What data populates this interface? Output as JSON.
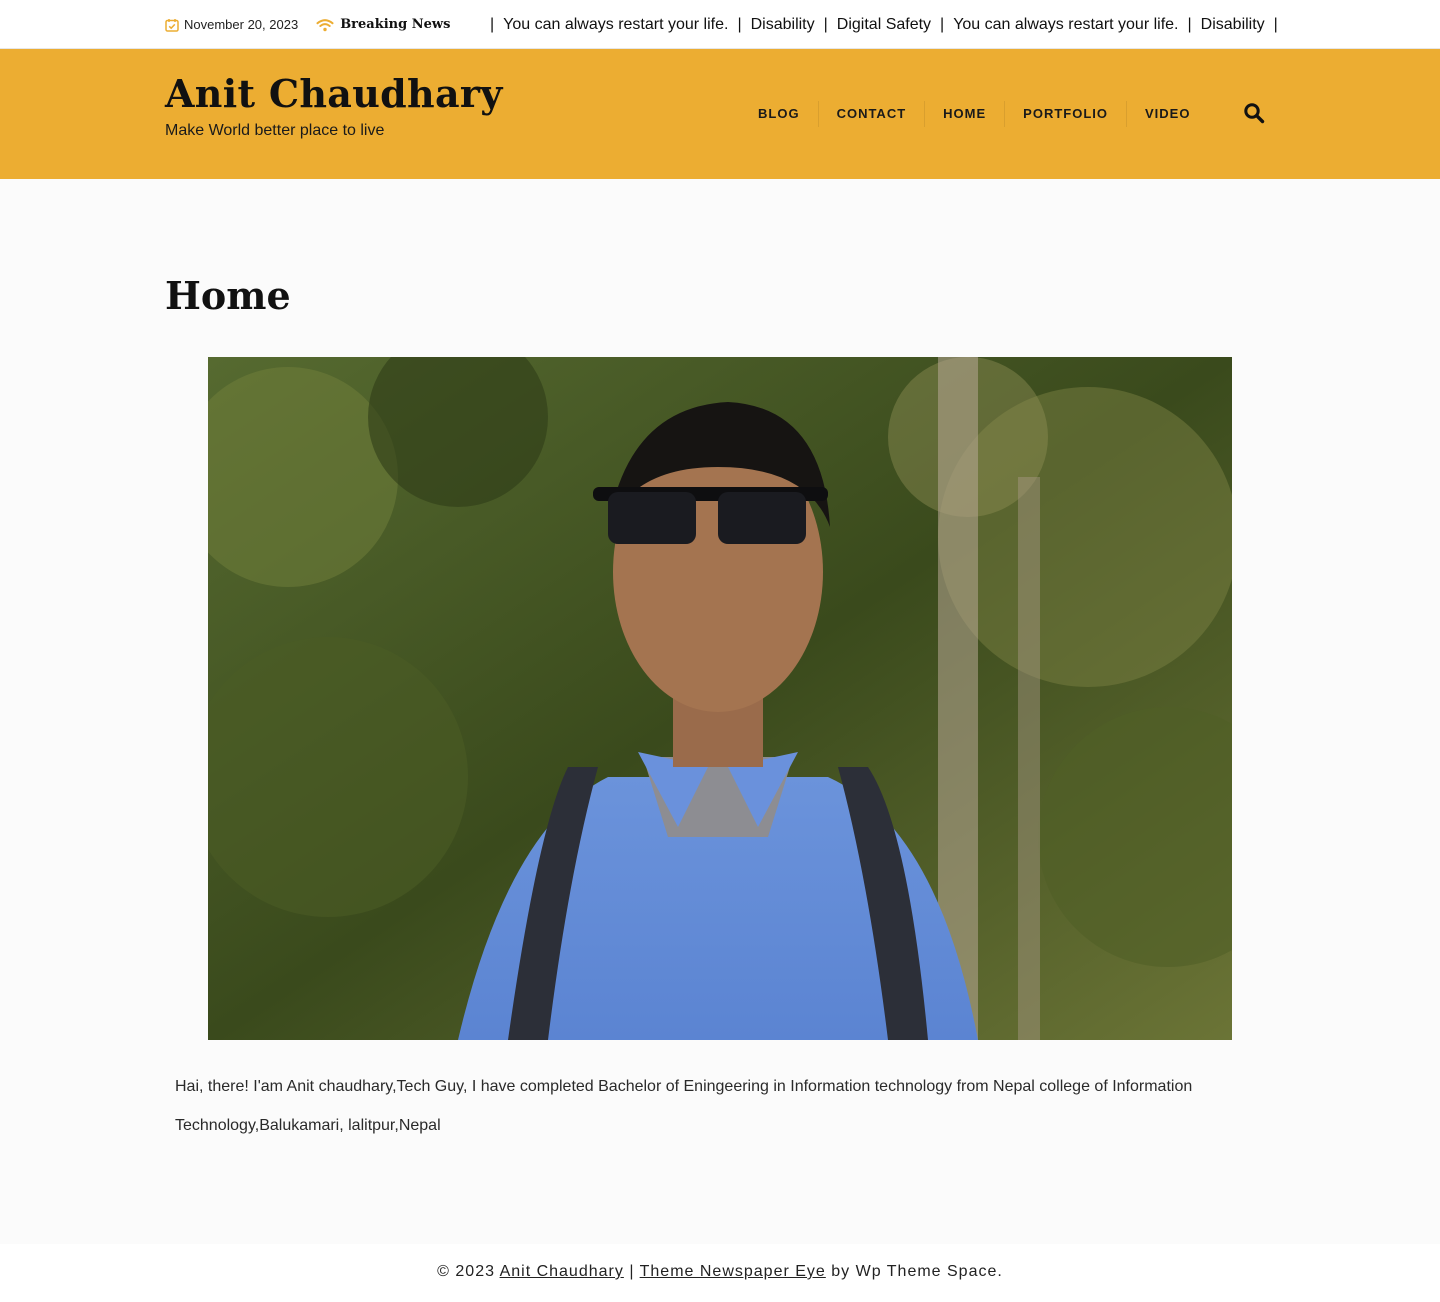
{
  "topbar": {
    "date": "November 20, 2023",
    "breaking_label": "Breaking News",
    "ticker": [
      "You can always restart your life.",
      "Disability",
      "Digital Safety",
      "You can always restart your life.",
      "Disability"
    ],
    "separator": "|"
  },
  "header": {
    "site_title": "Anit Chaudhary",
    "tagline": "Make World better place to live",
    "nav": [
      "BLOG",
      "CONTACT",
      "HOME",
      "PORTFOLIO",
      "VIDEO"
    ],
    "search_icon": "search-icon",
    "accent_color": "#ecad32"
  },
  "page": {
    "title": "Home",
    "intro": "Hai, there! I'am Anit chaudhary,Tech Guy, I have completed Bachelor of Eningeering in Information technology from Nepal college of Information Technology,Balukamari, lalitpur,Nepal"
  },
  "footer": {
    "copyright": "© 2023",
    "site_link": "Anit Chaudhary",
    "divider": "|",
    "theme_link": "Theme Newspaper Eye",
    "by_text": "by Wp Theme Space."
  }
}
